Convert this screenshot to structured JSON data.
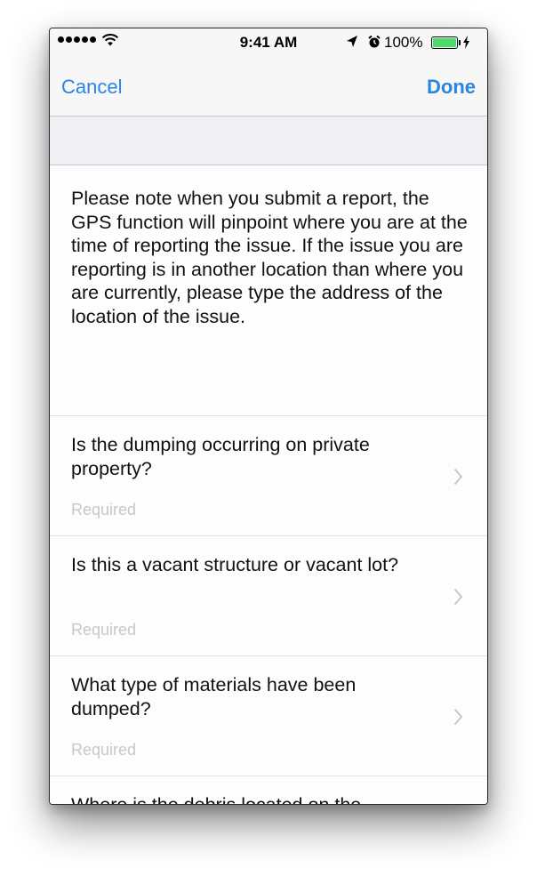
{
  "status_bar": {
    "time": "9:41 AM",
    "battery_percent": "100%",
    "battery_level": 1.0,
    "battery_color": "#4cd964",
    "icons": [
      "signal-dots-icon",
      "wifi-icon",
      "location-arrow-icon",
      "alarm-icon",
      "battery-icon",
      "charging-bolt-icon"
    ]
  },
  "nav": {
    "cancel_label": "Cancel",
    "done_label": "Done",
    "accent_color": "#2a85e2"
  },
  "notice": {
    "text": "Please note when you submit a report, the GPS function will pinpoint where you are at the time of reporting the issue.  If the issue you are reporting is in another location than where you are currently, please type the address of the location of the issue."
  },
  "questions": [
    {
      "title": "Is the dumping occurring on private property?",
      "hint": "Required"
    },
    {
      "title": "Is this a vacant structure or vacant lot?",
      "hint": "Required"
    },
    {
      "title": "What type of materials have been dumped?",
      "hint": "Required"
    },
    {
      "title": "Where is the debris located on the property?",
      "hint": ""
    }
  ]
}
